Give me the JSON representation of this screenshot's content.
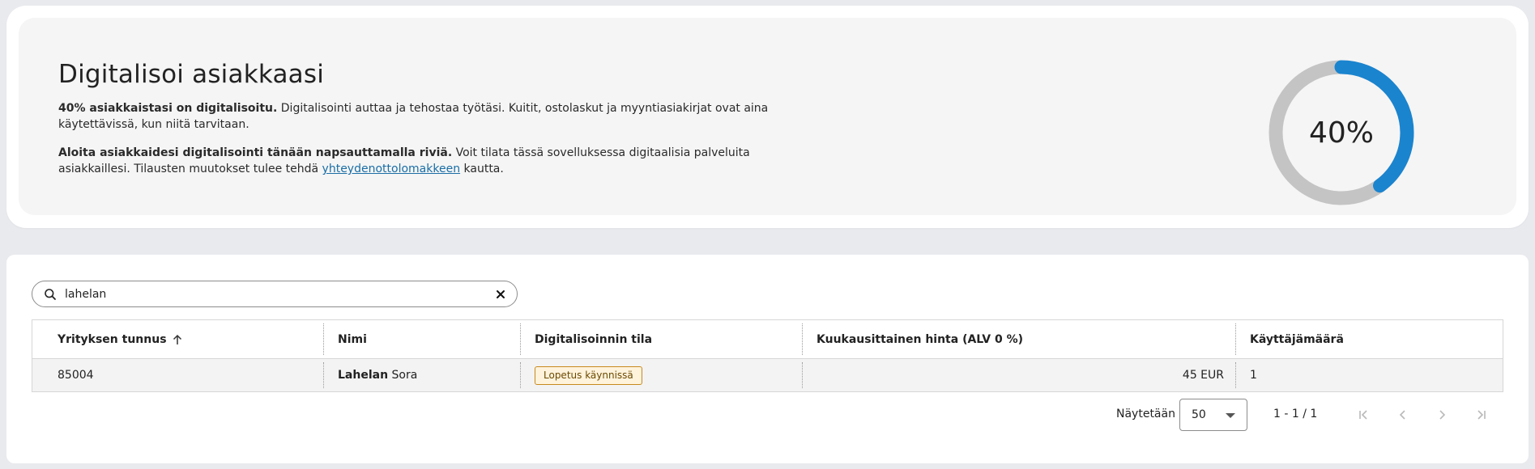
{
  "hero": {
    "title": "Digitalisoi asiakkaasi",
    "p1_bold": "40% asiakkaistasi on digitalisoitu.",
    "p1_rest": " Digitalisointi auttaa ja tehostaa työtäsi. Kuitit, ostolaskut ja myyntiasiakirjat ovat aina käytettävissä, kun niitä tarvitaan.",
    "p2_bold": "Aloita asiakkaidesi digitalisointi tänään napsauttamalla riviä.",
    "p2_rest": " Voit tilata tässä sovelluksessa digitaalisia palveluita asiakkaillesi. Tilausten muutokset tulee tehdä ",
    "p2_link": "yhteydenottolomakkeen",
    "p2_end": " kautta.",
    "progress_label": "40%",
    "progress_fraction": 0.4,
    "progress_color": "#1a84cf",
    "track_color": "#c4c4c4"
  },
  "search": {
    "value": "lahelan",
    "placeholder": ""
  },
  "table": {
    "columns": [
      "Yrityksen tunnus",
      "Nimi",
      "Digitalisoinnin tila",
      "Kuukausittainen hinta (ALV 0 %)",
      "Käyttäjämäärä"
    ],
    "sorted_column": "Yrityksen tunnus",
    "sort_direction": "ascending",
    "rows": [
      {
        "id": "85004",
        "name_bold": "Lahelan",
        "name_rest": " Sora",
        "status": "Lopetus käynnissä",
        "price": "45 EUR",
        "users": "1"
      }
    ]
  },
  "pager": {
    "label": "Näytetään",
    "page_size": "50",
    "range": "1 - 1 / 1"
  }
}
